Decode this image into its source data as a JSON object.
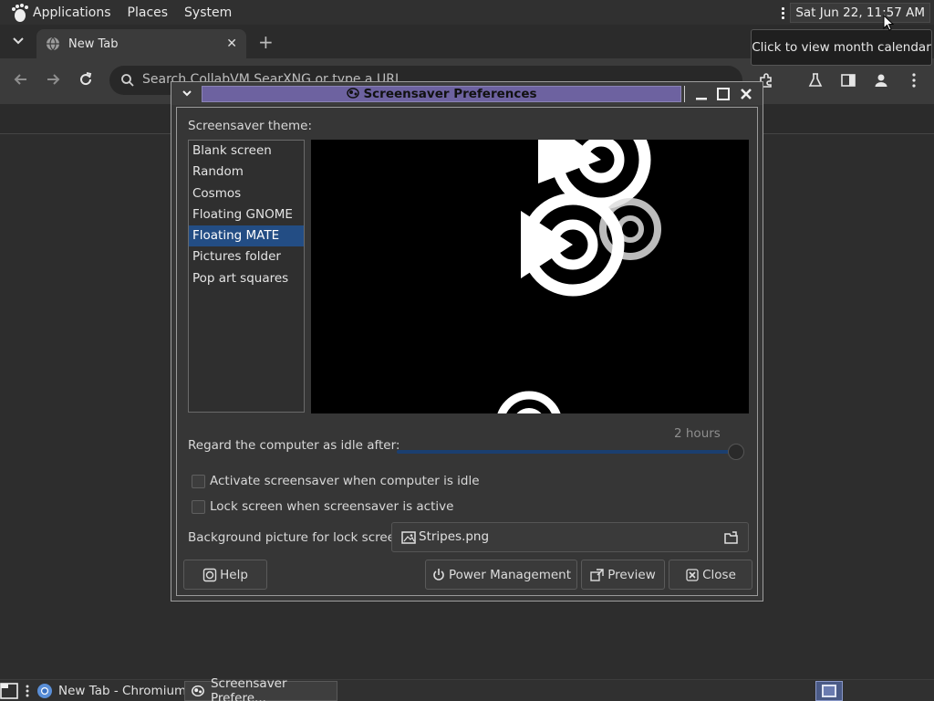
{
  "top_panel": {
    "menu_applications": "Applications",
    "menu_places": "Places",
    "menu_system": "System",
    "clock": "Sat Jun 22, 11:57 AM"
  },
  "tooltip": {
    "text": "Click to view month calendar"
  },
  "browser": {
    "tab_title": "New Tab",
    "omnibox_placeholder": "Search CollabVM SearXNG or type a URL"
  },
  "dialog": {
    "title": "Screensaver Preferences",
    "theme_label": "Screensaver theme:",
    "themes": [
      "Blank screen",
      "Random",
      "Cosmos",
      "Floating GNOME",
      "Floating MATE",
      "Pictures folder",
      "Pop art squares"
    ],
    "selected_theme": "Floating MATE",
    "idle_label": "Regard the computer as idle after:",
    "idle_value": "2 hours",
    "idle_slider_fraction": 1.0,
    "activate_label": "Activate screensaver when computer is idle",
    "activate_checked": false,
    "lock_label": "Lock screen when screensaver is active",
    "lock_checked": false,
    "background_label": "Background picture for lock screen:",
    "background_file": "Stripes.png",
    "buttons": {
      "help": "Help",
      "power": "Power Management",
      "preview": "Preview",
      "close": "Close"
    }
  },
  "taskbar": {
    "item1": "New Tab - Chromium",
    "item2": "Screensaver Prefere..."
  },
  "colors": {
    "selection": "#234d84",
    "titlebar": "#6d62a0",
    "slider": "#1b3f70"
  }
}
